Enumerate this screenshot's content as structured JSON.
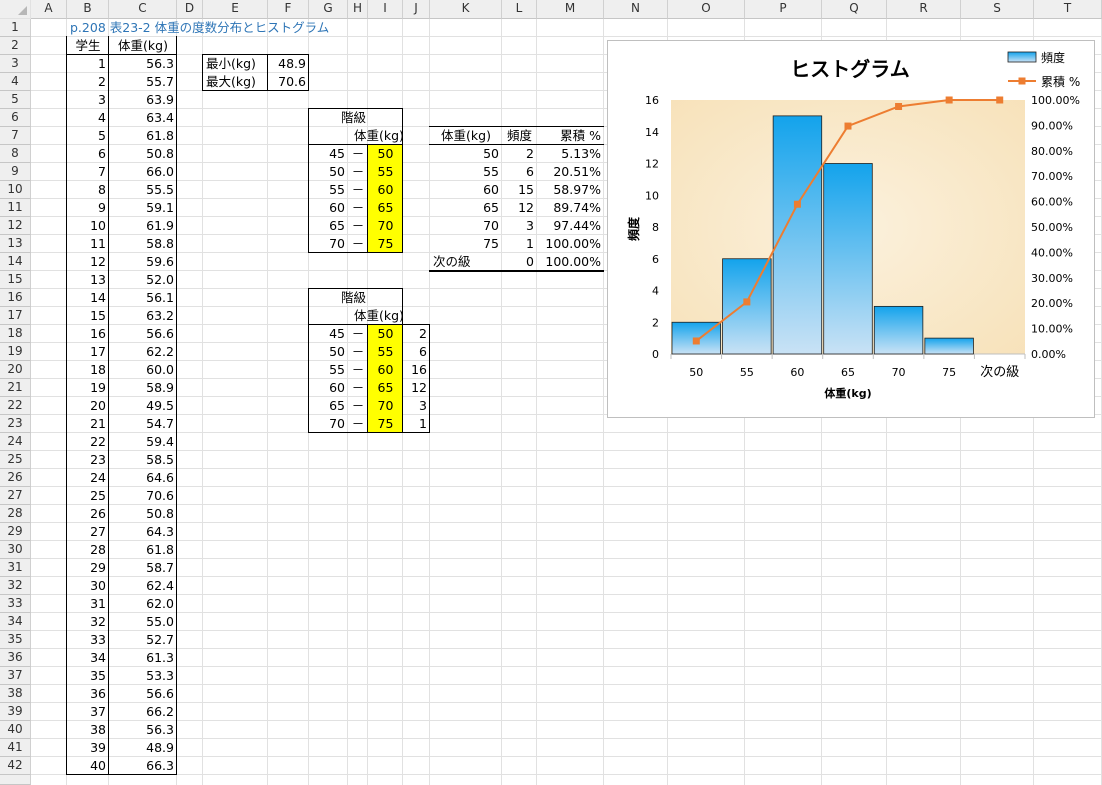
{
  "columns": [
    "A",
    "B",
    "C",
    "D",
    "E",
    "F",
    "G",
    "H",
    "I",
    "J",
    "K",
    "L",
    "M",
    "N",
    "O",
    "P",
    "Q",
    "R",
    "S",
    "T"
  ],
  "rows": 42,
  "title": "p.208  表23-2  体重の度数分布とヒストグラム",
  "student_header": "学生",
  "weight_header": "体重(kg)",
  "students": [
    [
      "1",
      "56.3"
    ],
    [
      "2",
      "55.7"
    ],
    [
      "3",
      "63.9"
    ],
    [
      "4",
      "63.4"
    ],
    [
      "5",
      "61.8"
    ],
    [
      "6",
      "50.8"
    ],
    [
      "7",
      "66.0"
    ],
    [
      "8",
      "55.5"
    ],
    [
      "9",
      "59.1"
    ],
    [
      "10",
      "61.9"
    ],
    [
      "11",
      "58.8"
    ],
    [
      "12",
      "59.6"
    ],
    [
      "13",
      "52.0"
    ],
    [
      "14",
      "56.1"
    ],
    [
      "15",
      "63.2"
    ],
    [
      "16",
      "56.6"
    ],
    [
      "17",
      "62.2"
    ],
    [
      "18",
      "60.0"
    ],
    [
      "19",
      "58.9"
    ],
    [
      "20",
      "49.5"
    ],
    [
      "21",
      "54.7"
    ],
    [
      "22",
      "59.4"
    ],
    [
      "23",
      "58.5"
    ],
    [
      "24",
      "64.6"
    ],
    [
      "25",
      "70.6"
    ],
    [
      "26",
      "50.8"
    ],
    [
      "27",
      "64.3"
    ],
    [
      "28",
      "61.8"
    ],
    [
      "29",
      "58.7"
    ],
    [
      "30",
      "62.4"
    ],
    [
      "31",
      "62.0"
    ],
    [
      "32",
      "55.0"
    ],
    [
      "33",
      "52.7"
    ],
    [
      "34",
      "61.3"
    ],
    [
      "35",
      "53.3"
    ],
    [
      "36",
      "56.6"
    ],
    [
      "37",
      "66.2"
    ],
    [
      "38",
      "56.3"
    ],
    [
      "39",
      "48.9"
    ],
    [
      "40",
      "66.3"
    ]
  ],
  "minmax": {
    "min_label": "最小(kg)",
    "min_value": "48.9",
    "max_label": "最大(kg)",
    "max_value": "70.6"
  },
  "class_table1": {
    "title": "階級",
    "subtitle": "体重(kg)",
    "dash": "－",
    "rows": [
      [
        "45",
        "50"
      ],
      [
        "50",
        "55"
      ],
      [
        "55",
        "60"
      ],
      [
        "60",
        "65"
      ],
      [
        "65",
        "70"
      ],
      [
        "70",
        "75"
      ]
    ]
  },
  "class_table2": {
    "title": "階級",
    "subtitle": "体重(kg)",
    "dash": "－",
    "rows": [
      [
        "45",
        "50",
        "2"
      ],
      [
        "50",
        "55",
        "6"
      ],
      [
        "55",
        "60",
        "16"
      ],
      [
        "60",
        "65",
        "12"
      ],
      [
        "65",
        "70",
        "3"
      ],
      [
        "70",
        "75",
        "1"
      ]
    ]
  },
  "freq_table": {
    "headers": [
      "体重(kg)",
      "頻度",
      "累積 %"
    ],
    "rows": [
      [
        "50",
        "2",
        "5.13%"
      ],
      [
        "55",
        "6",
        "20.51%"
      ],
      [
        "60",
        "15",
        "58.97%"
      ],
      [
        "65",
        "12",
        "89.74%"
      ],
      [
        "70",
        "3",
        "97.44%"
      ],
      [
        "75",
        "1",
        "100.00%"
      ],
      [
        "次の級",
        "0",
        "100.00%"
      ]
    ]
  },
  "chart_data": {
    "type": "bar",
    "title": "ヒストグラム",
    "xlabel": "体重(kg)",
    "ylabel": "頻度",
    "categories": [
      "50",
      "55",
      "60",
      "65",
      "70",
      "75",
      "次の級"
    ],
    "series": [
      {
        "name": "頻度",
        "type": "bar",
        "values": [
          2,
          6,
          15,
          12,
          3,
          1,
          0
        ],
        "axis": "left"
      },
      {
        "name": "累積 %",
        "type": "line",
        "values": [
          5.13,
          20.51,
          58.97,
          89.74,
          97.44,
          100.0,
          100.0
        ],
        "axis": "right"
      }
    ],
    "ylim": [
      0,
      16
    ],
    "yticks": [
      "0",
      "2",
      "4",
      "6",
      "8",
      "10",
      "12",
      "14",
      "16"
    ],
    "y2lim": [
      0,
      100
    ],
    "y2ticks": [
      "0.00%",
      "10.00%",
      "20.00%",
      "30.00%",
      "40.00%",
      "50.00%",
      "60.00%",
      "70.00%",
      "80.00%",
      "90.00%",
      "100.00%"
    ],
    "legend": "top-right",
    "colors": {
      "bar": "#29a8e8",
      "line": "#ed7d31"
    }
  }
}
